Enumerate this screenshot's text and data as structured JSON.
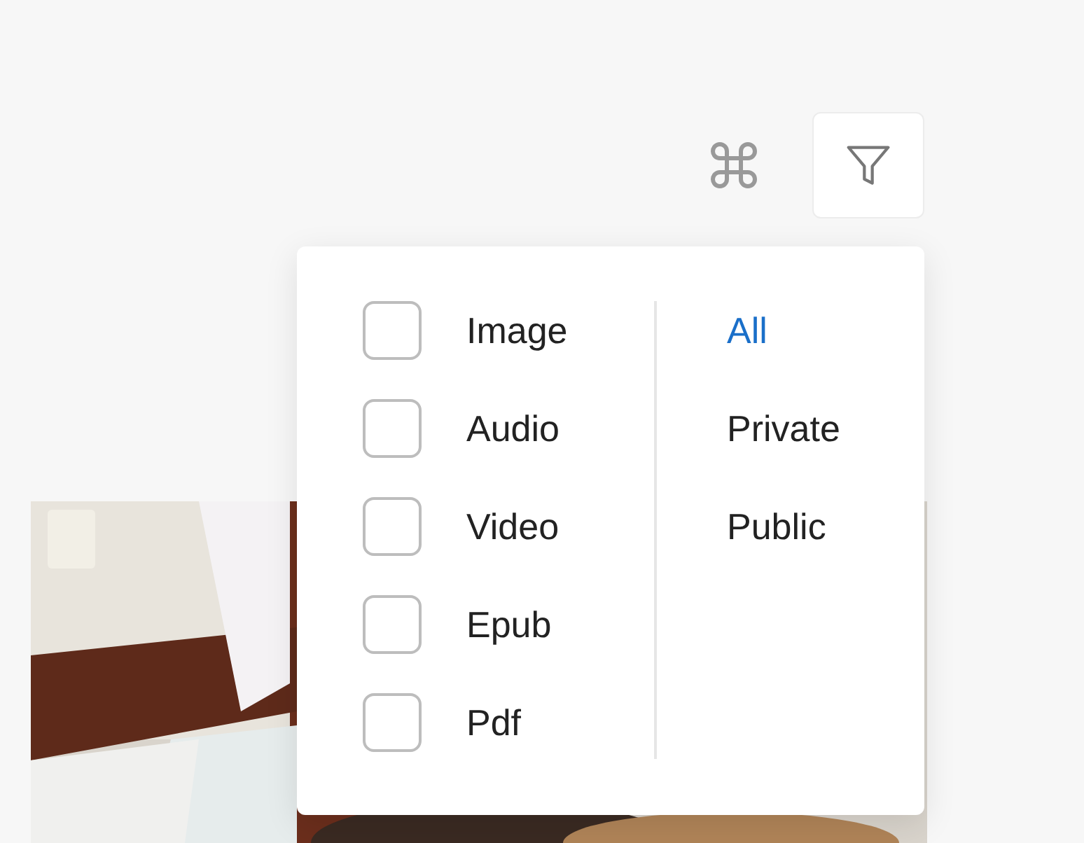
{
  "types": [
    {
      "label": "Image",
      "checked": false
    },
    {
      "label": "Audio",
      "checked": false
    },
    {
      "label": "Video",
      "checked": false
    },
    {
      "label": "Epub",
      "checked": false
    },
    {
      "label": "Pdf",
      "checked": false
    }
  ],
  "visibility": [
    {
      "label": "All",
      "selected": true
    },
    {
      "label": "Private",
      "selected": false
    },
    {
      "label": "Public",
      "selected": false
    }
  ]
}
